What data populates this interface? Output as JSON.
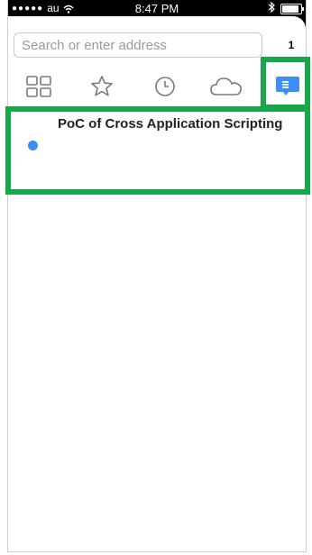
{
  "status_bar": {
    "signal": "●●●●●",
    "carrier": "au",
    "time": "8:47 PM",
    "icons": [
      "wifi-icon",
      "bluetooth-icon",
      "battery-icon"
    ]
  },
  "toolbar": {
    "search_placeholder": "Search or enter address",
    "tab_count": "1"
  },
  "tabbar": {
    "tabs": [
      {
        "icon": "grid-icon"
      },
      {
        "icon": "star-icon"
      },
      {
        "icon": "history-clock-icon"
      },
      {
        "icon": "cloud-icon"
      },
      {
        "icon": "reading-list-icon",
        "selected": true
      }
    ]
  },
  "list": {
    "items": [
      {
        "title": "PoC of Cross Application Scripting",
        "unread": true
      }
    ]
  },
  "colors": {
    "highlight": "#18a64a",
    "accent": "#3d8ef5"
  }
}
